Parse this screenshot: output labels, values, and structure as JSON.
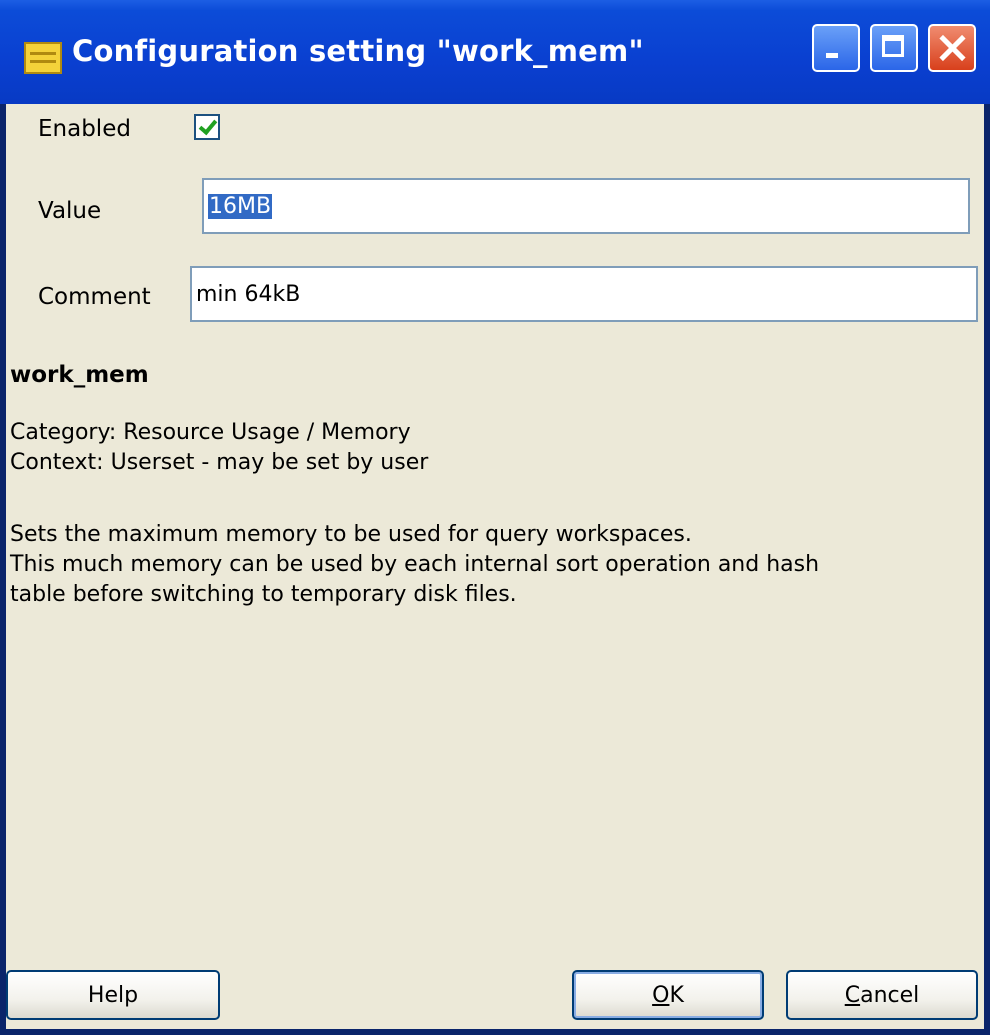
{
  "window": {
    "title": "Configuration setting \"work_mem\"",
    "icon": "settings-doc-icon",
    "controls": {
      "minimize": "minimize-icon",
      "maximize": "maximize-icon",
      "close": "close-icon"
    },
    "accent": "#0a3fd0"
  },
  "form": {
    "enabled_label": "Enabled",
    "enabled_checked": true,
    "value_label": "Value",
    "value": "16MB",
    "comment_label": "Comment",
    "comment": "min 64kB"
  },
  "info": {
    "name": "work_mem",
    "category": "Category: Resource Usage / Memory",
    "context": "Context: Userset - may be set by user",
    "description_lines": [
      "Sets the maximum memory to be used for query workspaces.",
      "This much memory can be used by each internal sort operation and hash",
      "table before switching to temporary disk files."
    ]
  },
  "buttons": {
    "help": "Help",
    "ok_mnemonic": "O",
    "ok_rest": "K",
    "cancel_mnemonic": "C",
    "cancel_rest": "ancel"
  }
}
